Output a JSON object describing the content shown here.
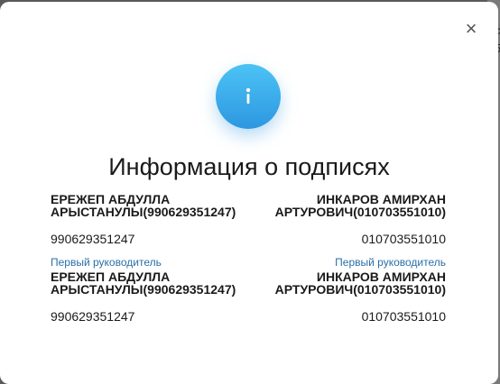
{
  "modal": {
    "title": "Информация о подписях",
    "close_label": "×",
    "info_icon": "info-icon"
  },
  "backdrop": {
    "peek_text": "c 5"
  },
  "signatures": {
    "left": [
      {
        "name": "ЕРЕЖЕП АБДУЛЛА АРЫСТАНУЛЫ(990629351247)",
        "id": "990629351247",
        "role": "Первый руководитель"
      },
      {
        "name": "ЕРЕЖЕП АБДУЛЛА АРЫСТАНУЛЫ(990629351247)",
        "id": "990629351247"
      }
    ],
    "right": [
      {
        "name": "ИНКАРОВ АМИРХАН АРТУРОВИЧ(010703551010)",
        "id": "010703551010",
        "role": "Первый руководитель"
      },
      {
        "name": "ИНКАРОВ АМИРХАН АРТУРОВИЧ(010703551010)",
        "id": "010703551010"
      }
    ]
  },
  "colors": {
    "accent": "#2d97e0",
    "role_link": "#2a6fa8"
  }
}
